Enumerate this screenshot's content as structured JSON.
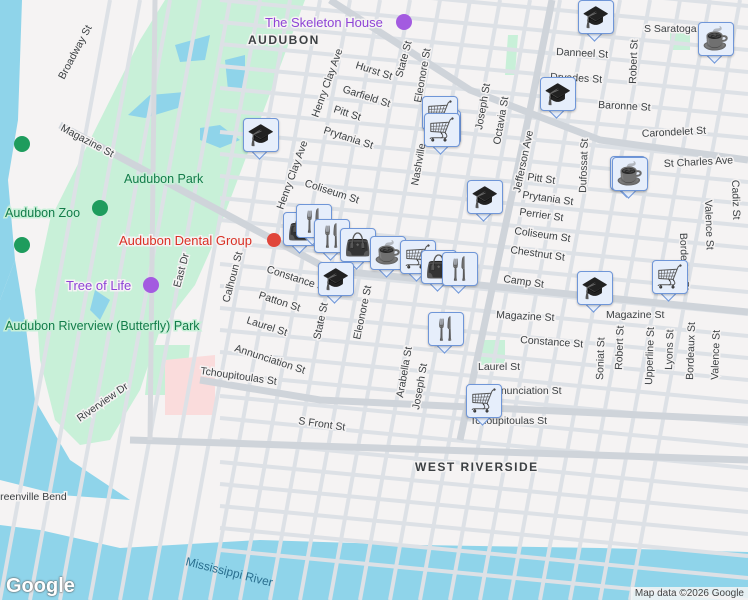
{
  "map": {
    "neighborhoods": [
      "AUDUBON",
      "WEST RIVERSIDE"
    ],
    "parks": [
      "Audubon Park",
      "Audubon Zoo",
      "Audubon Riverview (Butterfly) Park"
    ],
    "poi": {
      "skeleton_house": "The Skeleton House",
      "dental": "Audubon Dental Group",
      "tree_of_life": "Tree of Life"
    },
    "water": {
      "river": "Mississippi River",
      "bend": "Greenville Bend"
    },
    "streets": {
      "broadway": "Broadway St",
      "magazine": "Magazine St",
      "henry_clay": "Henry Clay Ave",
      "hurst": "Hurst St",
      "garfield": "Garfield St",
      "pitt": "Pitt St",
      "prytania": "Prytania St",
      "coliseum": "Coliseum St",
      "state": "State St",
      "eleonore": "Eleonore St",
      "joseph": "Joseph St",
      "octavia": "Octavia St",
      "jefferson": "Jefferson Ave",
      "nashville": "Nashville",
      "danneel": "Danneel St",
      "dryades": "Dryades St",
      "baronne": "Baronne St",
      "carondelet": "Carondelet St",
      "st_charles": "St Charles Ave",
      "saratoga": "S Saratoga",
      "robert": "Robert St",
      "dufossat": "Dufossat St",
      "perrier": "Perrier St",
      "chestnut": "Chestnut St",
      "camp": "Camp St",
      "constance": "Constance St",
      "laurel": "Laurel St",
      "annunciation": "Annunciation St",
      "tchoupitoulas": "Tchoupitoulas St",
      "s_front": "S Front St",
      "patton": "Patton St",
      "calhoun": "Calhoun St",
      "east_dr": "East Dr",
      "riverview": "Riverview Dr",
      "arabella": "Arabella St",
      "bordeaux": "Bordeaux St",
      "valence": "Valence St",
      "cadiz": "Cadiz St",
      "lyons": "Lyons St",
      "upperline": "Upperline St",
      "soniat": "Soniat St",
      "pitt2": "Pitt St",
      "prytania2": "Prytania St",
      "coliseum2": "Coliseum St",
      "magazine2": "Magazine St",
      "magazine3": "Magazine St",
      "constance2": "Constance St",
      "laurel2": "Laurel St",
      "annunciation2": "Annunciation St",
      "tchoupitoulas2": "Tchoupitoulas St",
      "bordeaux2": "Bordeaux St",
      "valence2": "Valence St",
      "robert2": "Robert St"
    },
    "markers": [
      "school",
      "shopping-cart",
      "school",
      "coffee",
      "school",
      "shopping-cart",
      "shopping-cart",
      "coffee",
      "school",
      "coffee",
      "shopping-bag",
      "restaurant",
      "restaurant",
      "shopping-bag",
      "coffee",
      "shopping-cart",
      "shopping-bag",
      "restaurant",
      "school",
      "school",
      "shopping-cart",
      "restaurant",
      "shopping-cart"
    ],
    "colors": {
      "water": "#8fd4ea",
      "park": "#c8f0d8",
      "road": "#d9dde3",
      "marker_bg": "#e6eefb",
      "marker_icon": "#0d3d63"
    }
  },
  "footer": {
    "logo": "Google",
    "attribution": "Map data ©2026 Google"
  }
}
